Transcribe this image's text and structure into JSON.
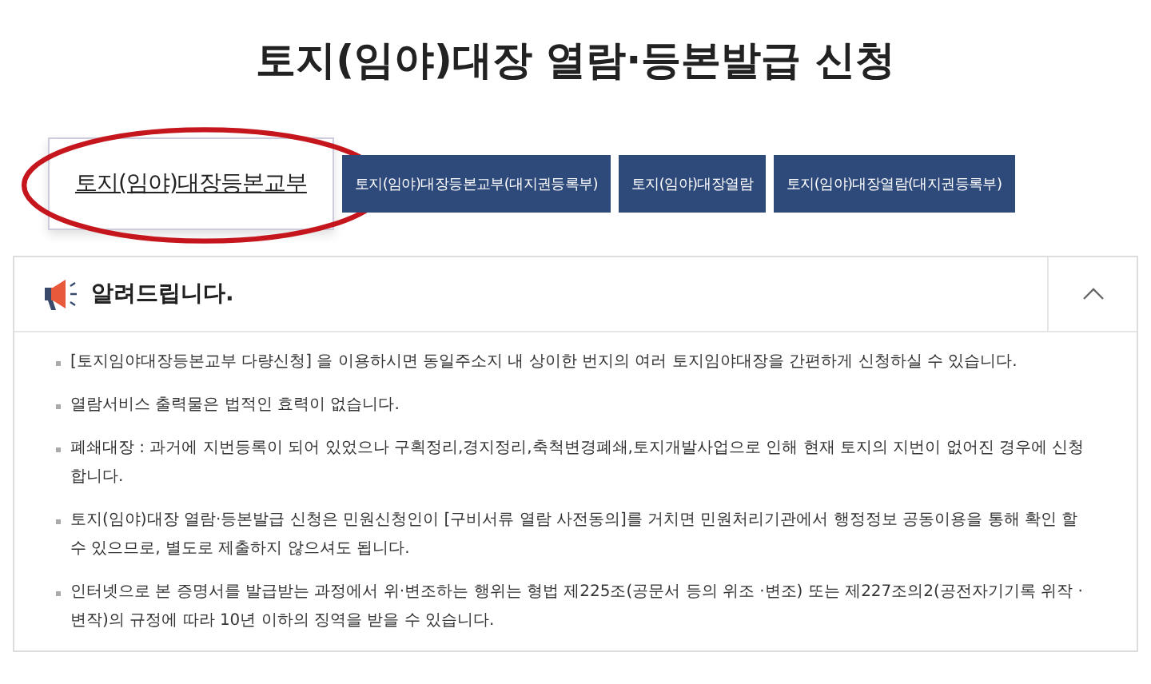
{
  "title": "토지(임야)대장 열람·등본발급 신청",
  "tabs": [
    {
      "label": "토지(임야)대장등본교부",
      "selected": true,
      "circled": true
    },
    {
      "label": "토지(임야)대장등본교부(대지권등록부)",
      "selected": false,
      "circled": false
    },
    {
      "label": "토지(임야)대장열람",
      "selected": false,
      "circled": false
    },
    {
      "label": "토지(임야)대장열람(대지권등록부)",
      "selected": false,
      "circled": false
    }
  ],
  "notice": {
    "title": "알려드립니다.",
    "expanded": true,
    "items": [
      "[토지임야대장등본교부 다량신청] 을 이용하시면 동일주소지 내 상이한 번지의 여러 토지임야대장을 간편하게 신청하실 수 있습니다.",
      "열람서비스 출력물은 법적인 효력이 없습니다.",
      "폐쇄대장 : 과거에 지번등록이 되어 있었으나 구획정리,경지정리,축척변경폐쇄,토지개발사업으로 인해 현재 토지의 지번이 없어진 경우에 신청합니다.",
      "토지(임야)대장 열람·등본발급 신청은 민원신청인이 [구비서류 열람 사전동의]를 거치면 민원처리기관에서 행정정보 공동이용을 통해 확인 할 수 있으므로, 별도로 제출하지 않으셔도 됩니다.",
      "인터넷으로 본 증명서를 발급받는 과정에서 위·변조하는 행위는 형법 제225조(공문서 등의 위조 ·변조) 또는 제227조의2(공전자기기록 위작 ·변작)의 규정에 따라 10년 이하의 징역을 받을 수 있습니다."
    ]
  }
}
